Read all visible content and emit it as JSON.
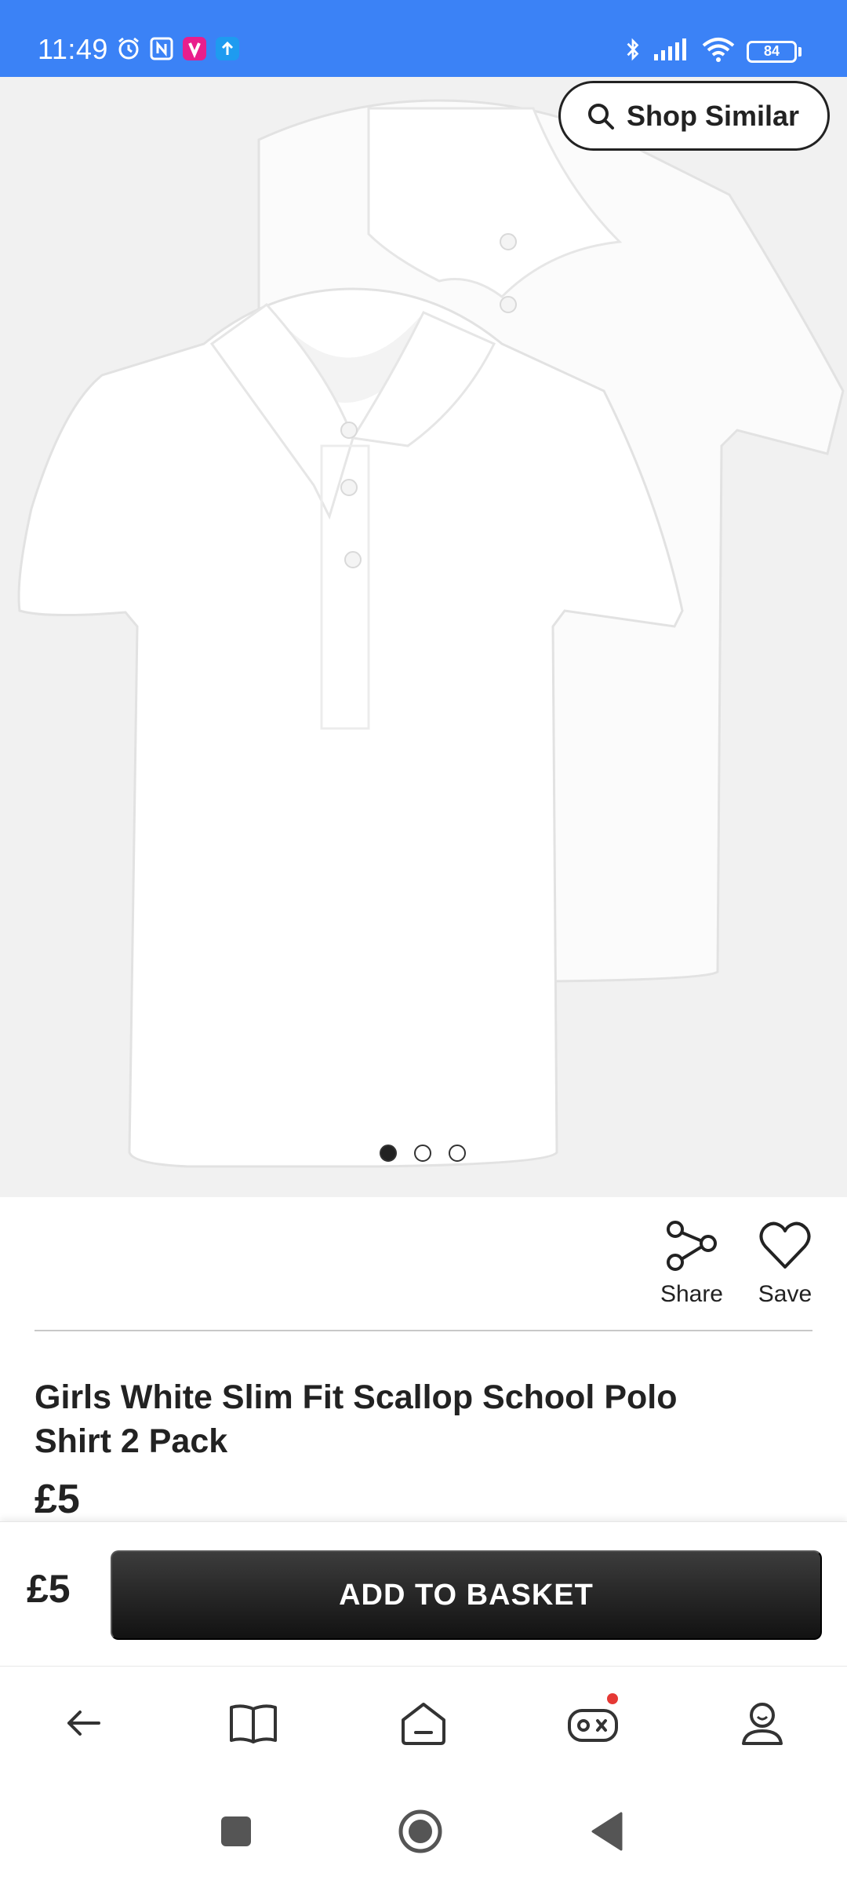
{
  "status_bar": {
    "time": "11:49",
    "battery": "84",
    "icons_left": [
      "alarm-icon",
      "nfc-icon",
      "app-notification-icon",
      "upload-icon"
    ],
    "icons_right": [
      "bluetooth-icon",
      "signal-icon",
      "wifi-icon",
      "battery-icon"
    ]
  },
  "product": {
    "image_alt": "Girls White Slim Fit Scallop School Polo Shirt 2 Pack",
    "carousel_dots": 3,
    "carousel_active_index": 0,
    "title": "Girls White Slim Fit Scallop School Polo Shirt 2 Pack",
    "price": "£5"
  },
  "shop_similar": {
    "label": "Shop Similar",
    "icon": "search-icon"
  },
  "actions": {
    "share_label": "Share",
    "save_label": "Save"
  },
  "basket": {
    "price": "£5",
    "button_label": "ADD TO BASKET"
  },
  "browser_nav": [
    "back-icon",
    "book-icon",
    "home-icon",
    "games-icon",
    "profile-icon"
  ],
  "system_nav": [
    "recents-icon",
    "home-circle-icon",
    "back-triangle-icon"
  ],
  "colors": {
    "status_bar": "#3b82f6",
    "button": "#1e1e1e",
    "notification_dot": "#e53935"
  }
}
